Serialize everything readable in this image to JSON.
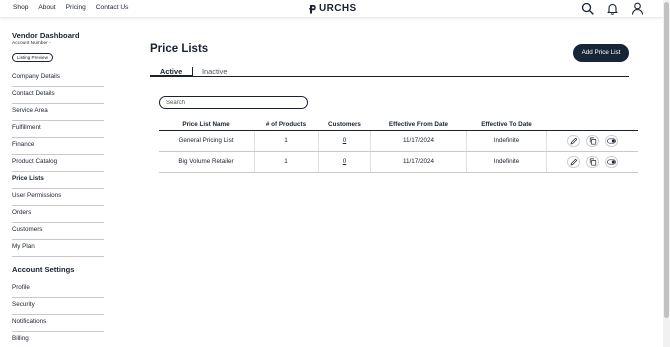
{
  "nav": {
    "links": [
      "Shop",
      "About",
      "Pricing",
      "Contact Us"
    ],
    "logo_text": "URCHS",
    "icons": [
      "search-icon",
      "bell-icon",
      "user-icon"
    ]
  },
  "sidebar": {
    "title": "Vendor Dashboard",
    "account_number": "Account Number -",
    "listing_preview": "Listing Preview",
    "items": [
      {
        "label": "Company Details"
      },
      {
        "label": "Contact Details"
      },
      {
        "label": "Service Area"
      },
      {
        "label": "Fulfillment"
      },
      {
        "label": "Finance"
      },
      {
        "label": "Product Catalog"
      },
      {
        "label": "Price Lists",
        "active": true
      },
      {
        "label": "User Permissions"
      },
      {
        "label": "Orders"
      },
      {
        "label": "Customers"
      },
      {
        "label": "My Plan"
      }
    ],
    "account_settings": {
      "title": "Account Settings",
      "items": [
        {
          "label": "Profile"
        },
        {
          "label": "Security"
        },
        {
          "label": "Notifications"
        },
        {
          "label": "Billing"
        }
      ]
    }
  },
  "main": {
    "title": "Price Lists",
    "add_button": "Add Price List",
    "tabs": [
      {
        "label": "Active",
        "active": true
      },
      {
        "label": "Inactive",
        "active": false
      }
    ],
    "search": {
      "placeholder": "Search",
      "value": ""
    },
    "table": {
      "columns": [
        "Price List Name",
        "# of Products",
        "Customers",
        "Effective From Date",
        "Effective To Date"
      ],
      "rows": [
        {
          "name": "General Pricing List",
          "products": "1",
          "customers": "0",
          "from": "11/17/2024",
          "to": "Indefinite"
        },
        {
          "name": "Big Volume Retailer",
          "products": "1",
          "customers": "0",
          "from": "11/17/2024",
          "to": "Indefinite"
        }
      ],
      "row_actions": [
        "edit-icon",
        "duplicate-icon",
        "toggle-icon"
      ]
    }
  },
  "colors": {
    "primary": "#172637",
    "divider": "#c9c9c9"
  }
}
